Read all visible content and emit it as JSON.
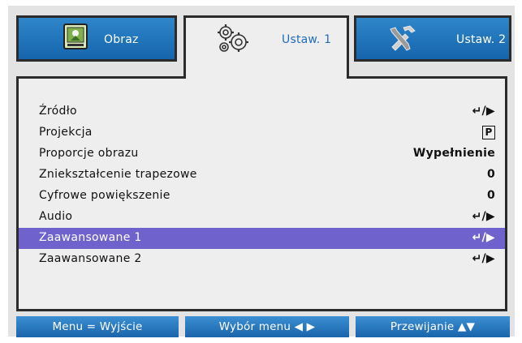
{
  "tabs": [
    {
      "label": "Obraz",
      "icon": "image-settings-icon",
      "active": false
    },
    {
      "label": "Ustaw. 1",
      "icon": "gears-icon",
      "active": true
    },
    {
      "label": "Ustaw. 2",
      "icon": "tools-icon",
      "active": false
    }
  ],
  "menu": {
    "items": [
      {
        "label": "Źródło",
        "value": "↵/▶"
      },
      {
        "label": "Projekcja",
        "value": "P"
      },
      {
        "label": "Proporcje obrazu",
        "value": "Wypełnienie"
      },
      {
        "label": "Zniekształcenie trapezowe",
        "value": "0"
      },
      {
        "label": "Cyfrowe powiększenie",
        "value": "0"
      },
      {
        "label": "Audio",
        "value": "↵/▶"
      },
      {
        "label": "Zaawansowane 1",
        "value": "↵/▶",
        "selected": true
      },
      {
        "label": "Zaawansowane 2",
        "value": "↵/▶"
      }
    ]
  },
  "footer": {
    "menu_exit": "Menu = Wyjście",
    "select_menu": "Wybór menu ◀ ▶",
    "scroll": "Przewijanie ▲▼"
  },
  "colors": {
    "tab_blue": "#1f74bd",
    "selection": "#6f62cc",
    "active_tab_text": "#1f6fb8"
  }
}
